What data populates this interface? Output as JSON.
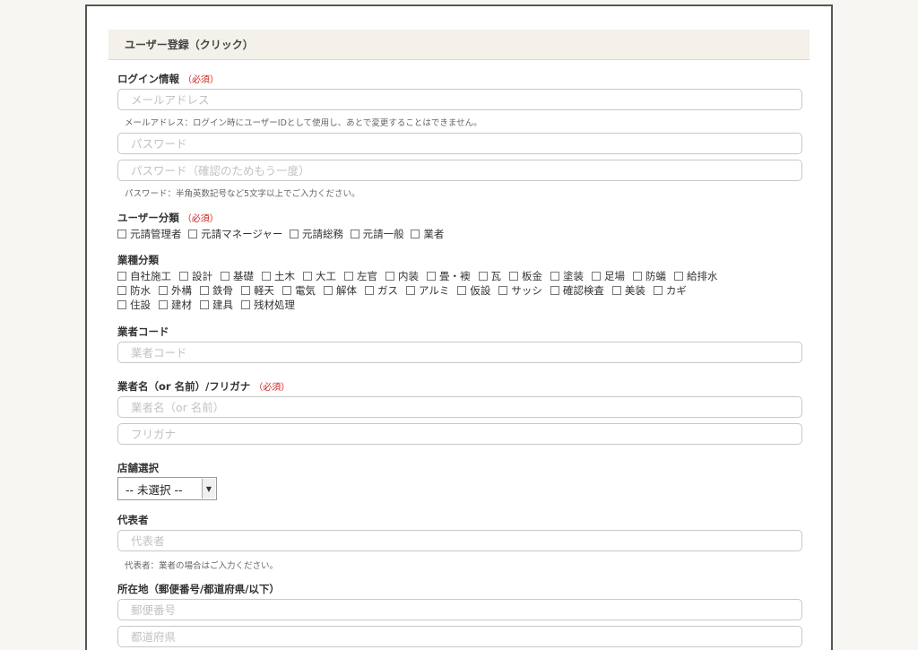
{
  "header": {
    "title": "ユーザー登録（クリック）"
  },
  "login": {
    "label": "ログイン情報",
    "required": "（必須）",
    "email_placeholder": "メールアドレス",
    "email_hint": "メールアドレス：ログイン時にユーザーIDとして使用し、あとで変更することはできません。",
    "password_placeholder": "パスワード",
    "password_confirm_placeholder": "パスワード（確認のためもう一度）",
    "password_hint": "パスワード：半角英数記号など5文字以上でご入力ください。"
  },
  "user_type": {
    "label": "ユーザー分類",
    "required": "（必須）",
    "options": [
      "元請管理者",
      "元請マネージャー",
      "元請総務",
      "元請一般",
      "業者"
    ]
  },
  "trades": {
    "label": "業種分類",
    "rows": [
      [
        "自社施工",
        "設計",
        "基礎",
        "土木",
        "大工",
        "左官",
        "内装",
        "畳・襖",
        "瓦",
        "板金",
        "塗装",
        "足場",
        "防蟻",
        "給排水"
      ],
      [
        "防水",
        "外構",
        "鉄骨",
        "軽天",
        "電気",
        "解体",
        "ガス",
        "アルミ",
        "仮設",
        "サッシ",
        "確認検査",
        "美装",
        "カギ"
      ],
      [
        "住設",
        "建材",
        "建具",
        "残材処理"
      ]
    ]
  },
  "vendor_code": {
    "label": "業者コード",
    "placeholder": "業者コード"
  },
  "vendor_name": {
    "label": "業者名（or 名前）/フリガナ",
    "required": "（必須）",
    "name_placeholder": "業者名（or 名前）",
    "kana_placeholder": "フリガナ"
  },
  "store": {
    "label": "店舗選択",
    "selected": "-- 未選択 --"
  },
  "representative": {
    "label": "代表者",
    "placeholder": "代表者",
    "hint": "代表者：業者の場合はご入力ください。"
  },
  "address": {
    "label": "所在地（郵便番号/都道府県/以下）",
    "postal_placeholder": "郵便番号",
    "prefecture_placeholder": "都道府県"
  },
  "colors": {
    "required": "#d0201a",
    "header_bg": "#f3f1ea",
    "page_bg": "#f7f6f2"
  }
}
